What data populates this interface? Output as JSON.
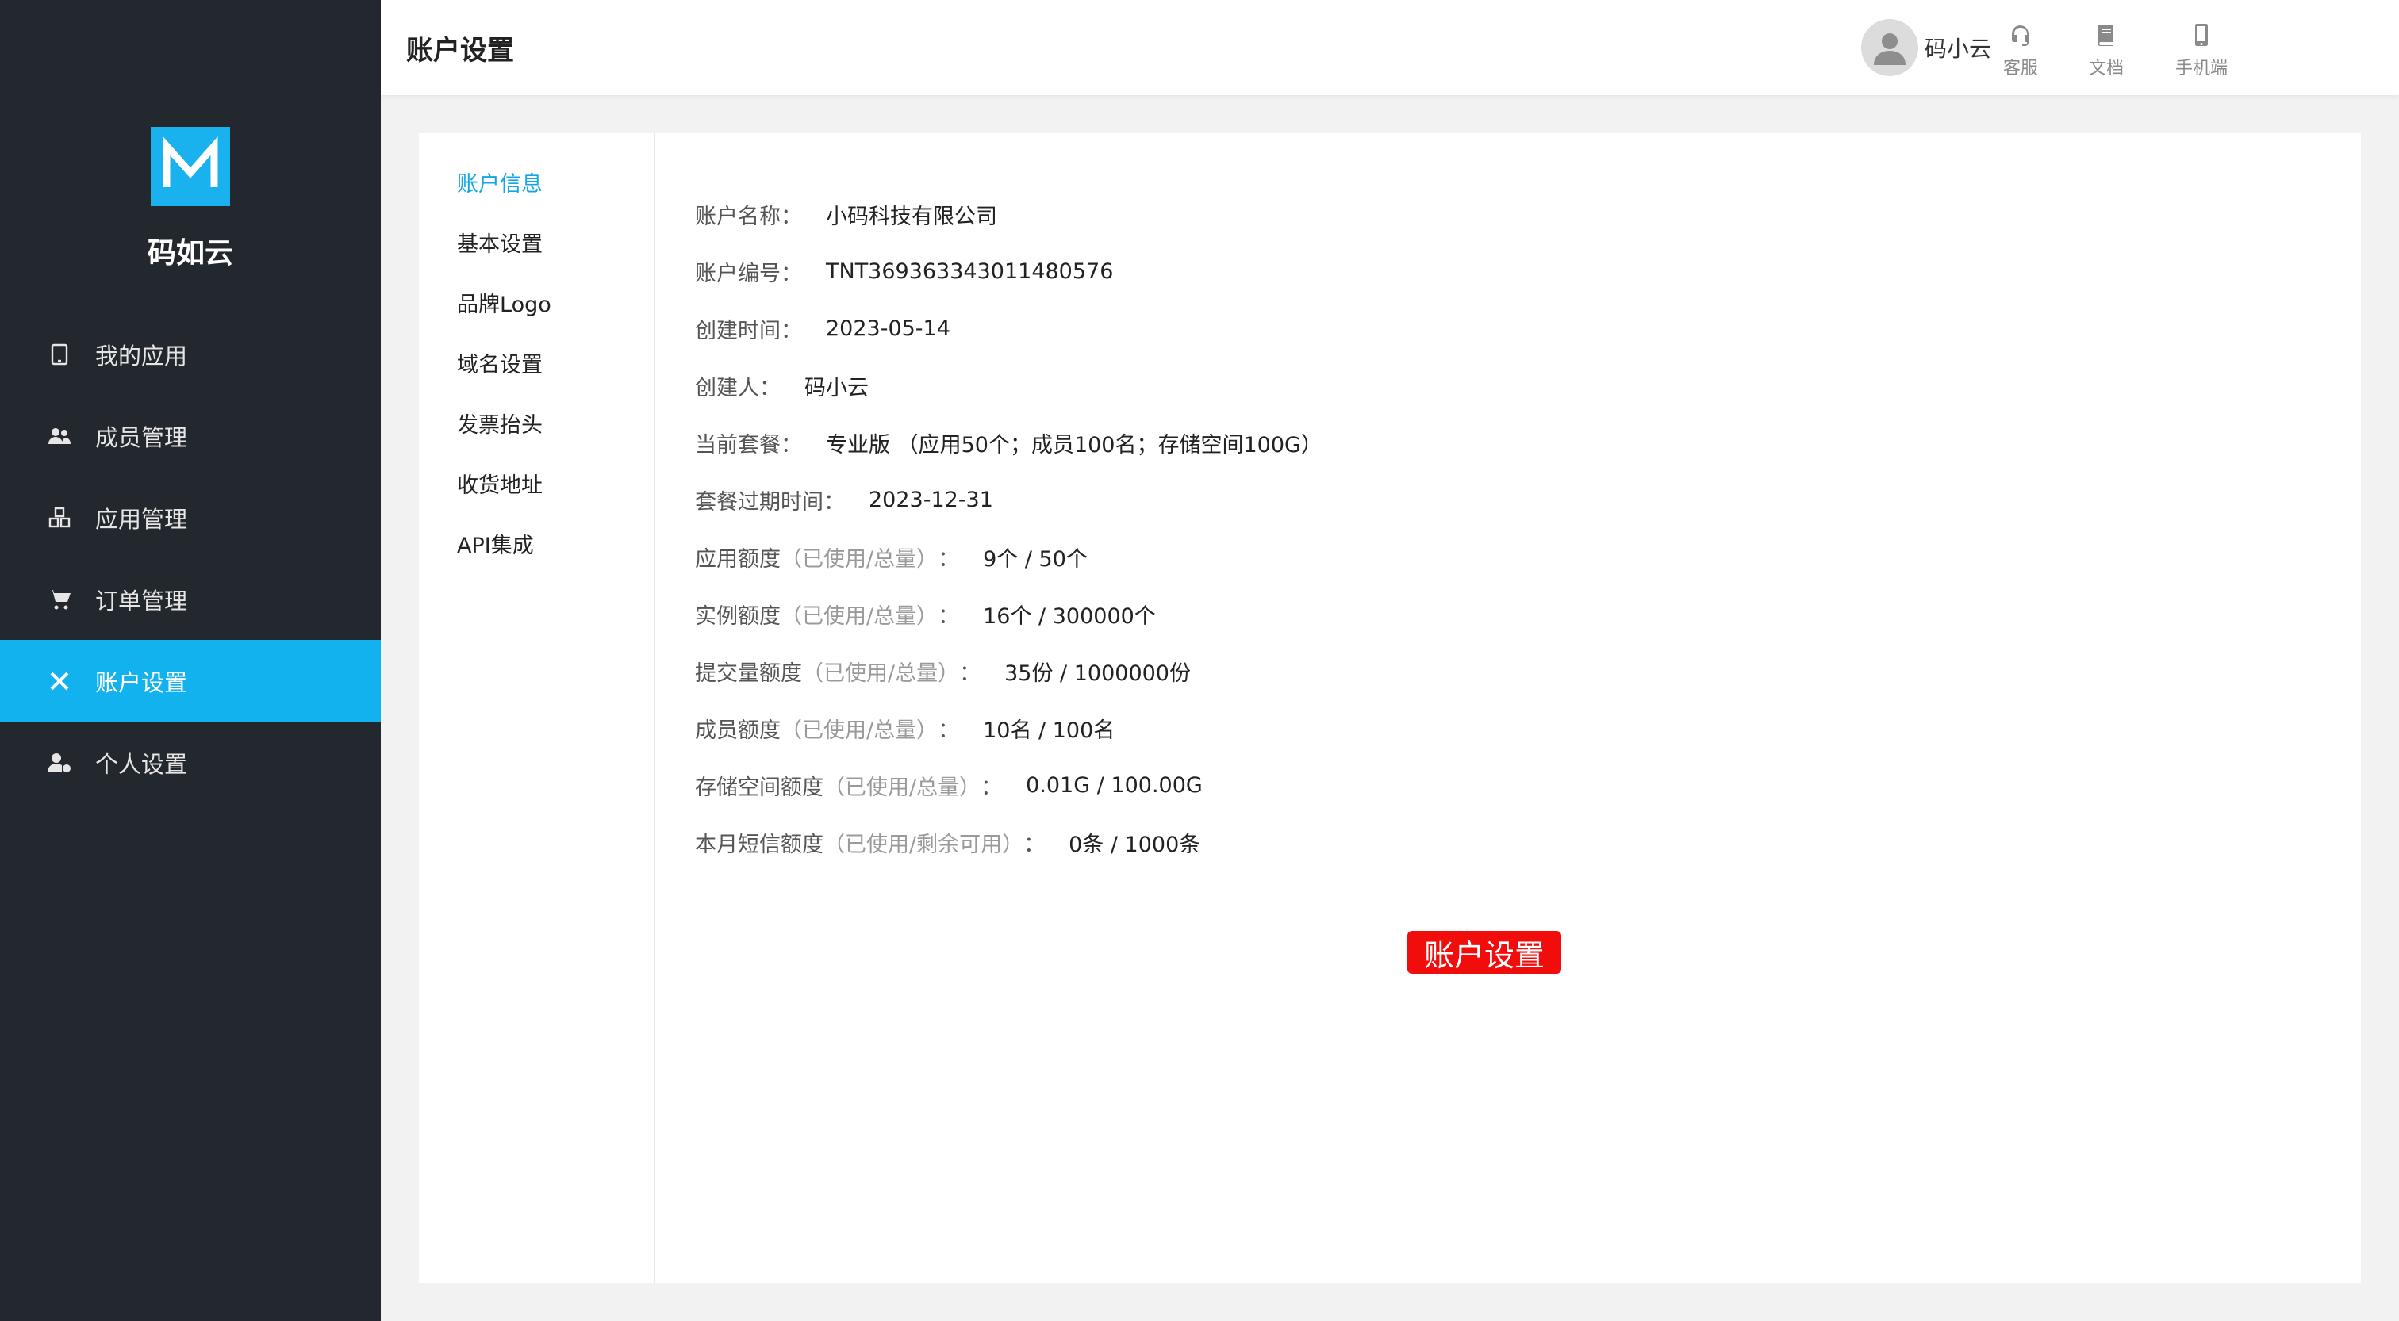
{
  "sidebar": {
    "brand": "码如云",
    "logo_letter": "M",
    "items": [
      {
        "label": "我的应用",
        "icon": "tablet-icon",
        "active": false
      },
      {
        "label": "成员管理",
        "icon": "users-icon",
        "active": false
      },
      {
        "label": "应用管理",
        "icon": "cubes-icon",
        "active": false
      },
      {
        "label": "订单管理",
        "icon": "cart-icon",
        "active": false
      },
      {
        "label": "账户设置",
        "icon": "tools-icon",
        "active": true
      },
      {
        "label": "个人设置",
        "icon": "user-gear-icon",
        "active": false
      }
    ],
    "bg_color": "#23272e",
    "active_color": "#12b2ee"
  },
  "header": {
    "title": "账户设置",
    "tools": [
      {
        "label": "客服",
        "icon": "headset-icon"
      },
      {
        "label": "文档",
        "icon": "book-icon"
      },
      {
        "label": "手机端",
        "icon": "mobile-icon"
      }
    ],
    "username": "码小云"
  },
  "subnav": {
    "items": [
      "账户信息",
      "基本设置",
      "品牌Logo",
      "域名设置",
      "发票抬头",
      "收货地址",
      "API集成"
    ],
    "active_index": 0
  },
  "account": {
    "name_label": "账户名称",
    "name": "小码科技有限公司",
    "id_label": "账户编号",
    "id": "TNT369363343011480576",
    "created_label": "创建时间",
    "created": "2023-05-14",
    "creator_label": "创建人",
    "creator": "码小云",
    "plan_label": "当前套餐",
    "plan": "专业版 （应用50个；成员100名；存储空间100G）",
    "expire_label": "套餐过期时间",
    "expire": "2023-12-31",
    "note_used_total": "（已使用/总量）",
    "note_used_remaining": "（已使用/剩余可用）",
    "quota_app_label": "应用额度",
    "quota_app": "9个 / 50个",
    "quota_instance_label": "实例额度",
    "quota_instance": "16个 / 300000个",
    "quota_submission_label": "提交量额度",
    "quota_submission": "35份 / 1000000份",
    "quota_member_label": "成员额度",
    "quota_member": "10名 / 100名",
    "quota_storage_label": "存储空间额度",
    "quota_storage": "0.01G / 100.00G",
    "quota_sms_label": "本月短信额度",
    "quota_sms": "0条 / 1000条"
  },
  "overlay_tag": "账户设置",
  "colors": {
    "accent": "#12a6e6",
    "overlay": "#f20d0d"
  }
}
